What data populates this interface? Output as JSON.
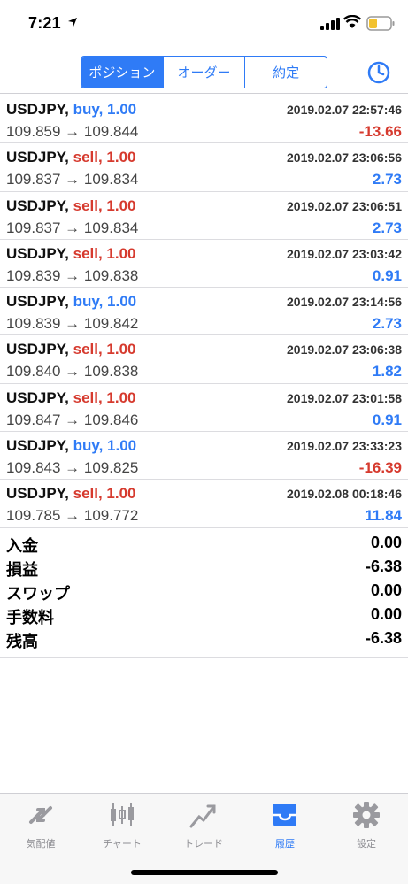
{
  "status": {
    "time": "7:21"
  },
  "tabs_top": [
    {
      "label": "ポジション",
      "active": true
    },
    {
      "label": "オーダー",
      "active": false
    },
    {
      "label": "約定",
      "active": false
    }
  ],
  "trades": [
    {
      "symbol": "USDJPY,",
      "side": "buy",
      "lot": "buy, 1.00",
      "time": "2019.02.07 22:57:46",
      "prices": "109.859 → 109.844",
      "profit": "-13.66"
    },
    {
      "symbol": "USDJPY,",
      "side": "sell",
      "lot": "sell, 1.00",
      "time": "2019.02.07 23:06:56",
      "prices": "109.837 → 109.834",
      "profit": "2.73"
    },
    {
      "symbol": "USDJPY,",
      "side": "sell",
      "lot": "sell, 1.00",
      "time": "2019.02.07 23:06:51",
      "prices": "109.837 → 109.834",
      "profit": "2.73"
    },
    {
      "symbol": "USDJPY,",
      "side": "sell",
      "lot": "sell, 1.00",
      "time": "2019.02.07 23:03:42",
      "prices": "109.839 → 109.838",
      "profit": "0.91"
    },
    {
      "symbol": "USDJPY,",
      "side": "buy",
      "lot": "buy, 1.00",
      "time": "2019.02.07 23:14:56",
      "prices": "109.839 → 109.842",
      "profit": "2.73"
    },
    {
      "symbol": "USDJPY,",
      "side": "sell",
      "lot": "sell, 1.00",
      "time": "2019.02.07 23:06:38",
      "prices": "109.840 → 109.838",
      "profit": "1.82"
    },
    {
      "symbol": "USDJPY,",
      "side": "sell",
      "lot": "sell, 1.00",
      "time": "2019.02.07 23:01:58",
      "prices": "109.847 → 109.846",
      "profit": "0.91"
    },
    {
      "symbol": "USDJPY,",
      "side": "buy",
      "lot": "buy, 1.00",
      "time": "2019.02.07 23:33:23",
      "prices": "109.843 → 109.825",
      "profit": "-16.39"
    },
    {
      "symbol": "USDJPY,",
      "side": "sell",
      "lot": "sell, 1.00",
      "time": "2019.02.08 00:18:46",
      "prices": "109.785 → 109.772",
      "profit": "11.84"
    }
  ],
  "summary": [
    {
      "label": "入金",
      "value": "0.00"
    },
    {
      "label": "損益",
      "value": "-6.38"
    },
    {
      "label": "スワップ",
      "value": "0.00"
    },
    {
      "label": "手数料",
      "value": "0.00"
    },
    {
      "label": "残高",
      "value": "-6.38"
    }
  ],
  "bottom_tabs": [
    {
      "label": "気配値",
      "icon": "arrows-icon",
      "active": false
    },
    {
      "label": "チャート",
      "icon": "candlestick-icon",
      "active": false
    },
    {
      "label": "トレード",
      "icon": "trend-icon",
      "active": false
    },
    {
      "label": "履歴",
      "icon": "inbox-icon",
      "active": true
    },
    {
      "label": "設定",
      "icon": "gear-icon",
      "active": false
    }
  ],
  "colors": {
    "accent": "#2f7bf6",
    "negative": "#d63a2e",
    "positive": "#2f7bf6"
  }
}
